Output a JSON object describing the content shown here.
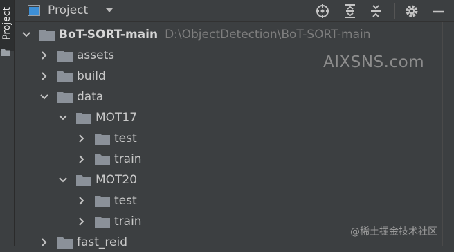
{
  "sidebar": {
    "tab_label": "Project"
  },
  "toolbar": {
    "title": "Project",
    "icons": [
      "locate-icon",
      "expand-all-icon",
      "collapse-all-icon",
      "gear-icon",
      "minimize-icon"
    ]
  },
  "tree": {
    "root": {
      "name": "BoT-SORT-main",
      "path": "D:\\ObjectDetection\\BoT-SORT-main"
    },
    "items": [
      {
        "name": "assets",
        "expanded": false
      },
      {
        "name": "build",
        "expanded": false
      },
      {
        "name": "data",
        "expanded": true
      },
      {
        "name": "MOT17",
        "expanded": true
      },
      {
        "name": "test",
        "expanded": false
      },
      {
        "name": "train",
        "expanded": false
      },
      {
        "name": "MOT20",
        "expanded": true
      },
      {
        "name": "test",
        "expanded": false
      },
      {
        "name": "train",
        "expanded": false
      },
      {
        "name": "fast_reid",
        "expanded": false
      }
    ]
  },
  "overlay": {
    "watermark": "AIXSNS.com",
    "credit": "@稀土掘金技术社区"
  },
  "colors": {
    "background": "#3c3f41",
    "folder": "#8b9199",
    "text": "#c9c9c9",
    "path": "#7e7e7e"
  }
}
